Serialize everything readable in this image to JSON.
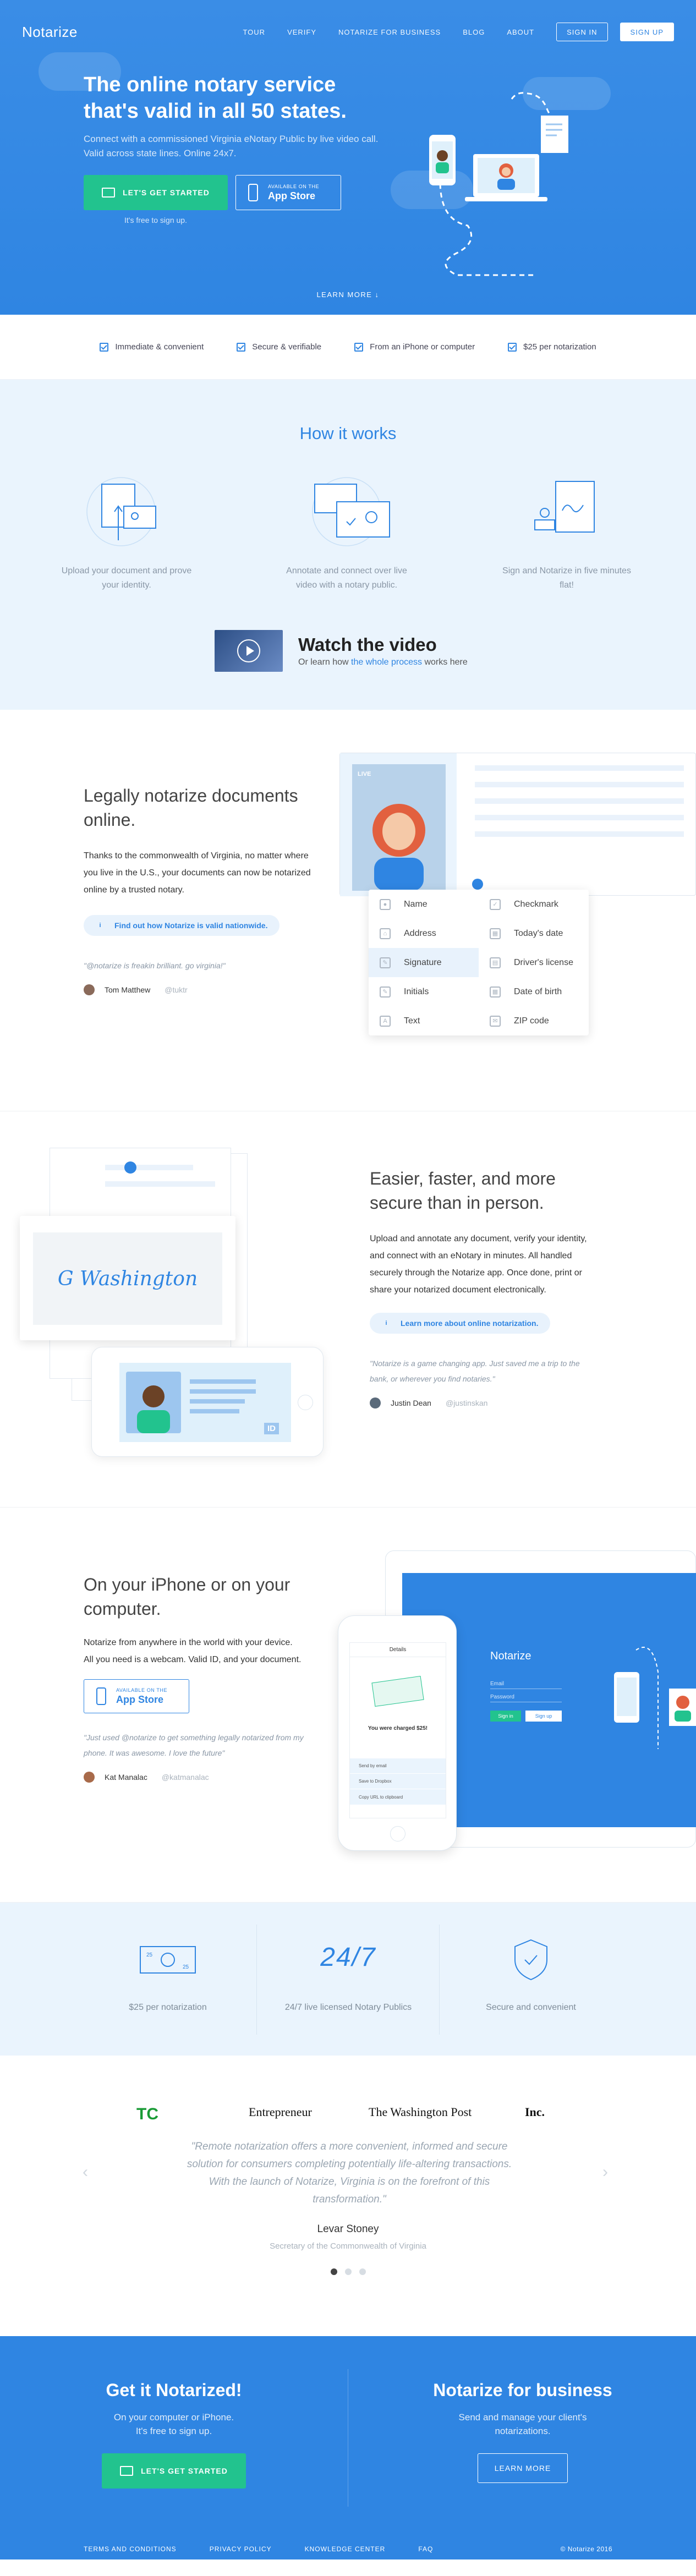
{
  "nav": {
    "logo": "Notarize",
    "links": [
      "TOUR",
      "VERIFY",
      "NOTARIZE FOR BUSINESS",
      "BLOG",
      "ABOUT"
    ],
    "sign_in": "SIGN IN",
    "sign_up": "SIGN UP"
  },
  "hero": {
    "title": "The online notary service that's valid in all 50 states.",
    "subtitle": "Connect with a commissioned Virginia eNotary Public by live video call. Valid across state lines. Online 24x7.",
    "cta": "LET'S GET STARTED",
    "store_small": "AVAILABLE ON THE",
    "store_big": "App Store",
    "free_note": "It's free to sign up.",
    "learn_more": "LEARN MORE ↓"
  },
  "features": [
    "Immediate & convenient",
    "Secure & verifiable",
    "From an iPhone or computer",
    "$25 per notarization"
  ],
  "how": {
    "title": "How it works",
    "steps": [
      "Upload your document and prove your identity.",
      "Annotate and connect over live video with a notary public.",
      "Sign and Notarize in five minutes flat!"
    ],
    "video_title": "Watch the video",
    "video_sub_pre": "Or learn how",
    "video_sub_link": "the whole process",
    "video_sub_post": "works here"
  },
  "legal": {
    "title": "Legally notarize documents online.",
    "body": "Thanks to the commonwealth of Virginia, no matter where you live in the U.S., your documents can now be notarized online by a trusted notary.",
    "pill": "Find out how Notarize is valid nationwide.",
    "quote": "\"@notarize is freakin brilliant. go virginia!\"",
    "author": "Tom Matthew",
    "handle": "@tuktr",
    "live": "LIVE",
    "fields_left": [
      "Name",
      "Address",
      "Signature",
      "Initials",
      "Text"
    ],
    "fields_right": [
      "Checkmark",
      "Today's date",
      "Driver's license",
      "Date of birth",
      "ZIP code"
    ]
  },
  "easier": {
    "title": "Easier, faster, and more secure than in person.",
    "body": "Upload and annotate any document, verify your identity, and connect with an eNotary in minutes. All handled securely through the Notarize app. Once done, print or share your notarized document electronically.",
    "pill": "Learn more about online notarization.",
    "quote": "\"Notarize is a game changing app. Just saved me a trip to the bank, or wherever you find notaries.\"",
    "author": "Justin Dean",
    "handle": "@justinskan",
    "signature": "G Washington",
    "id_label": "ID"
  },
  "iphone": {
    "title": "On your iPhone or on your computer.",
    "body": "Notarize from anywhere in the world with your device. All you need is a webcam. Valid ID, and your document.",
    "store_small": "AVAILABLE ON THE",
    "store_big": "App Store",
    "quote": "\"Just used @notarize to get something legally notarized from my phone. It was awesome. I love the future\"",
    "author": "Kat Manalac",
    "handle": "@katmanalac",
    "phone_header": "Details",
    "phone_charged": "You were charged $25!",
    "phone_list": [
      "Send by email",
      "Save to Dropbox",
      "Copy URL to clipboard"
    ],
    "laptop_logo": "Notarize",
    "laptop_email": "Email",
    "laptop_password": "Password",
    "laptop_signin": "Sign in",
    "laptop_signup": "Sign up"
  },
  "benefits": [
    {
      "label": "$25 per notarization",
      "icon": "25"
    },
    {
      "label": "24/7 live licensed Notary Publics",
      "icon": "24/7"
    },
    {
      "label": "Secure and convenient",
      "icon": "shield"
    }
  ],
  "press": {
    "logos": [
      "TC",
      "Entrepreneur",
      "The Washington Post",
      "Inc."
    ],
    "quote": "\"Remote notarization offers a more convenient, informed and secure solution for consumers completing potentially life-altering transactions. With the launch of Notarize, Virginia is on the forefront of this transformation.\"",
    "name": "Levar Stoney",
    "role": "Secretary of the Commonwealth of Virginia"
  },
  "cta": {
    "left_title": "Get it Notarized!",
    "left_body": "On your computer or iPhone. It's free to sign up.",
    "left_btn": "LET'S GET STARTED",
    "right_title": "Notarize for business",
    "right_body": "Send and manage your client's notarizations.",
    "right_btn": "LEARN MORE"
  },
  "footer": {
    "links": [
      "TERMS AND CONDITIONS",
      "PRIVACY POLICY",
      "KNOWLEDGE CENTER",
      "FAQ"
    ],
    "copyright": "© Notarize 2016"
  },
  "colors": {
    "brand_blue": "#2f85e2",
    "green": "#22c38e",
    "light_blue_bg": "#eaf4fd"
  }
}
